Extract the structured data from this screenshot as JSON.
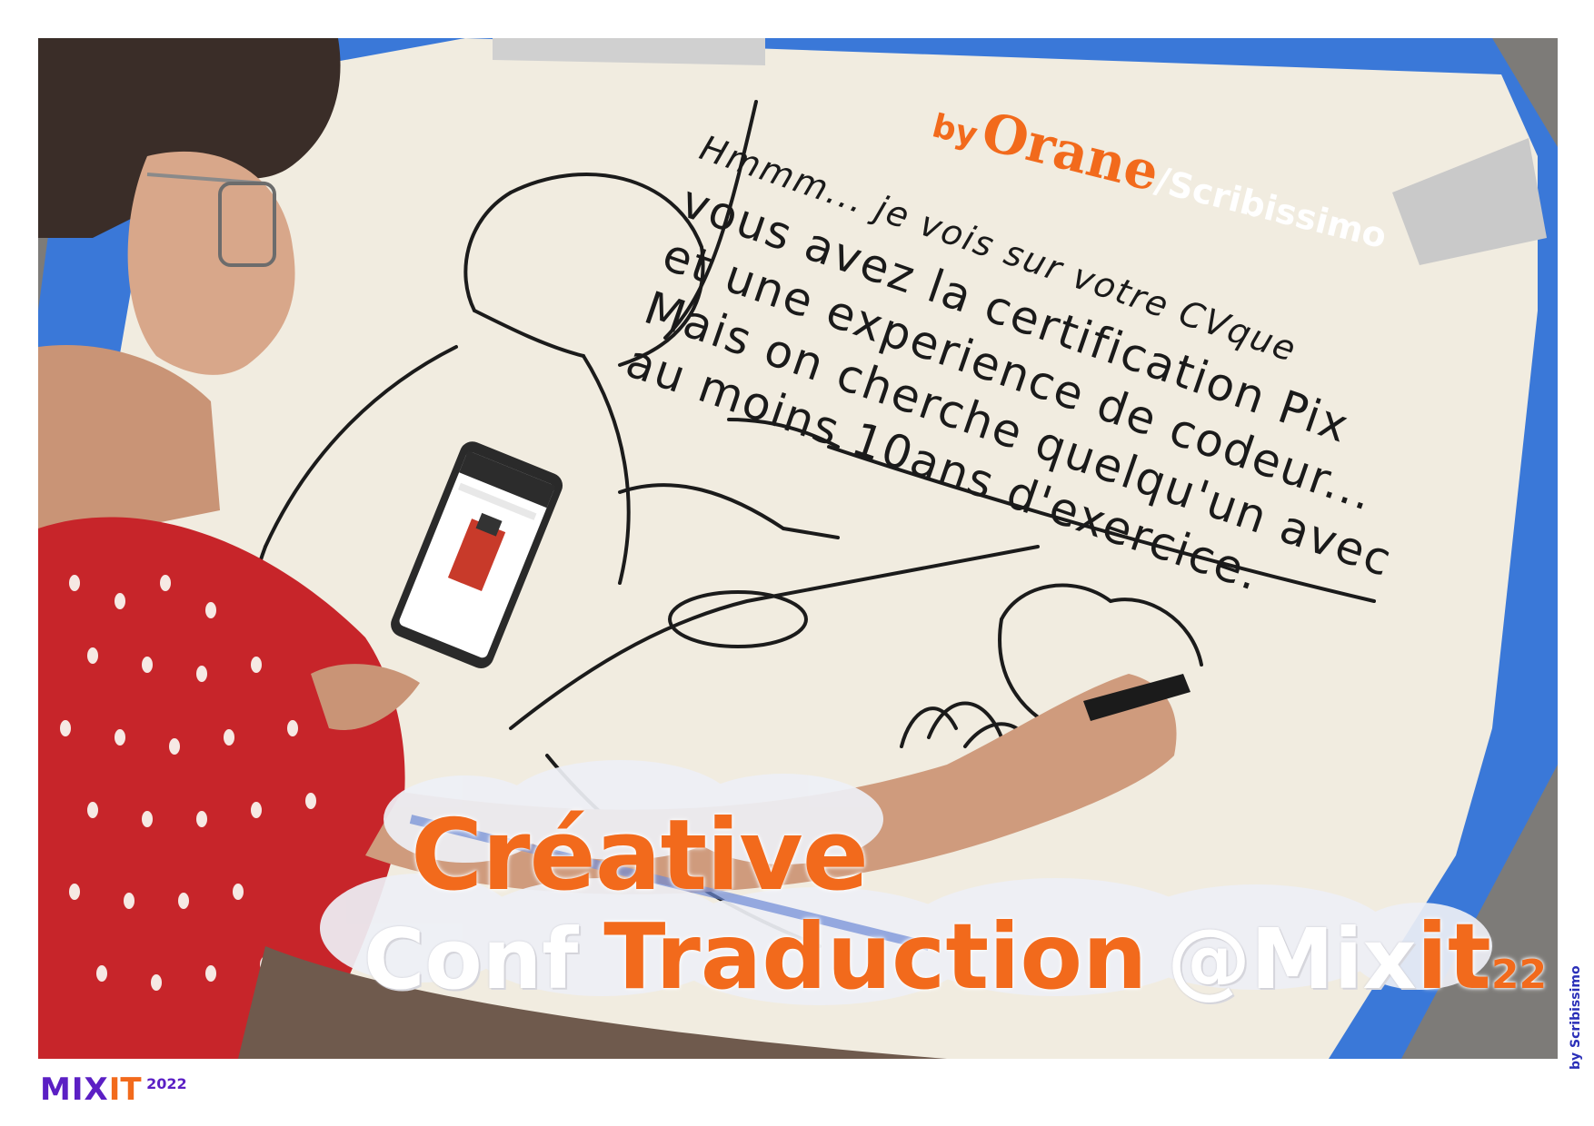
{
  "photo": {
    "description_icon": "photo-icon"
  },
  "speech_bubble": {
    "lines": [
      "Hmmm... je vois sur votre CVque",
      "vous avez la certification Pix",
      "et une experience de codeur...",
      "Mais on cherche quelqu'un avec",
      "au moins 10ans d'exercice."
    ]
  },
  "credit": {
    "by": "by",
    "name": "Orane",
    "separator": "/",
    "studio": "Scribissimo"
  },
  "title": {
    "line1": "Créative",
    "conf": "Conf",
    "traduction": "Traduction",
    "at_mix": "@Mix",
    "it": "it",
    "year": "22"
  },
  "side_credit": "by Scribissimo",
  "logo": {
    "mix": "MIX",
    "it": "IT",
    "year": "2022"
  },
  "colors": {
    "orange": "#f26a1c",
    "blue": "#2d6fd6",
    "purple": "#5b1fc4",
    "paper": "#f3efe4"
  }
}
